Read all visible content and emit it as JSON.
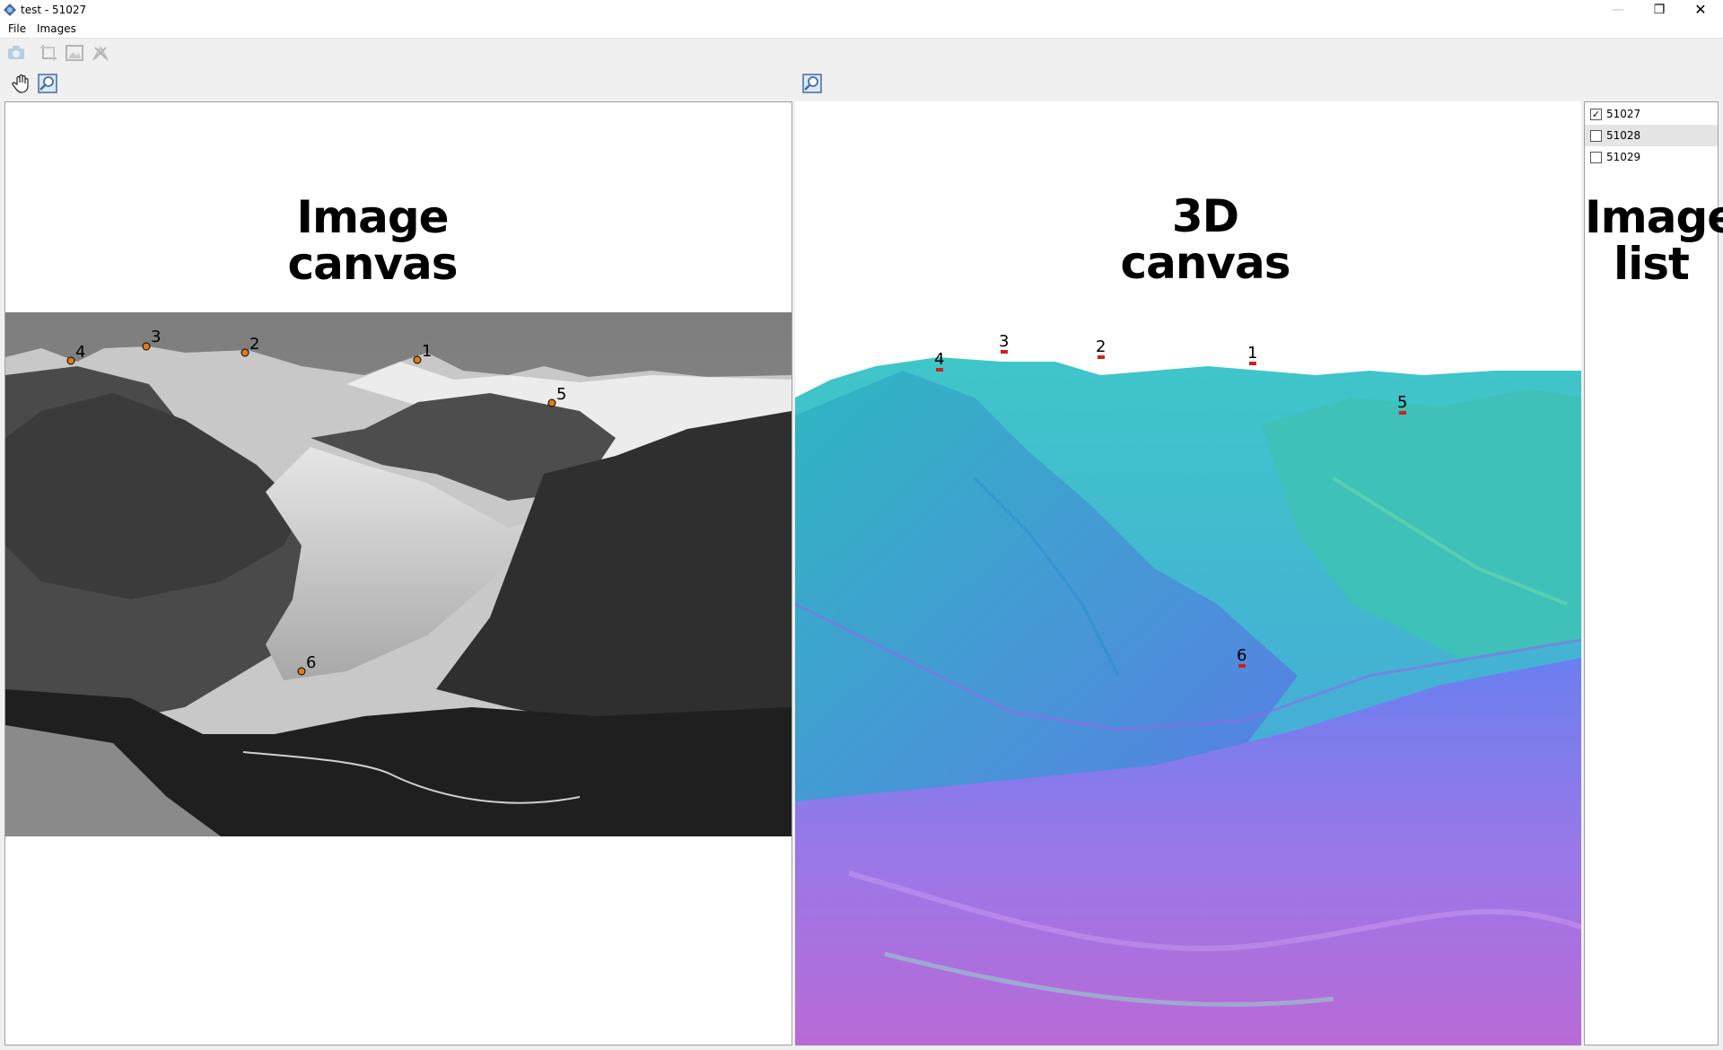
{
  "window": {
    "title": "test - 51027"
  },
  "menu": {
    "file": "File",
    "images": "Images"
  },
  "toolbar": {
    "icons": [
      "camera-icon",
      "crop-icon",
      "image-icon",
      "remove-icon",
      "hand-pan-icon",
      "zoom-fit-icon",
      "zoom-fit-3d-icon"
    ]
  },
  "image_canvas": {
    "title_line1": "Image",
    "title_line2": "canvas",
    "markers": [
      "1",
      "2",
      "3",
      "4",
      "5",
      "6"
    ]
  },
  "canvas_3d": {
    "title_line1": "3D",
    "title_line2": "canvas",
    "markers": [
      "1",
      "2",
      "3",
      "4",
      "5",
      "6"
    ]
  },
  "image_list": {
    "title_line1": "Image",
    "title_line2": "list",
    "items": [
      {
        "label": "51027",
        "checked": true
      },
      {
        "label": "51028",
        "checked": false
      },
      {
        "label": "51029",
        "checked": false
      }
    ]
  }
}
